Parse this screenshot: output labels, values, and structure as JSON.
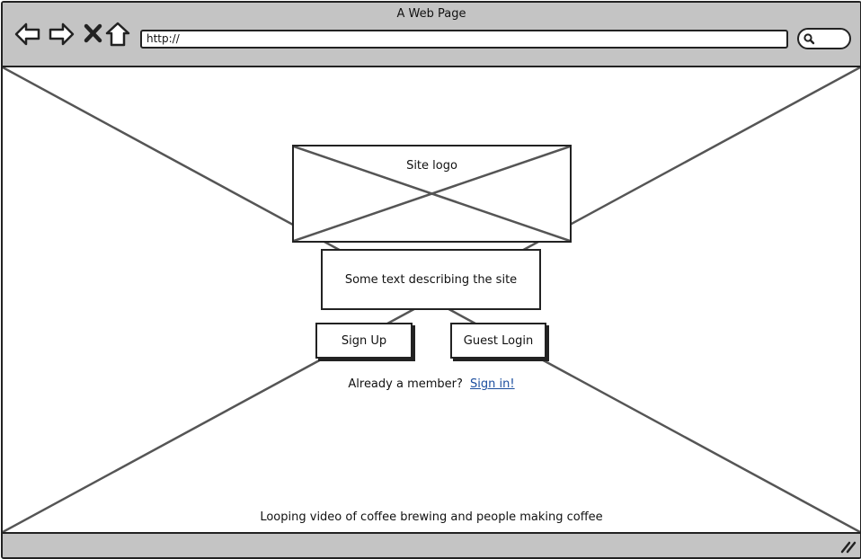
{
  "window": {
    "title": "A Web Page"
  },
  "toolbar": {
    "back_icon": "back-arrow-icon",
    "forward_icon": "forward-arrow-icon",
    "stop_icon": "close-icon",
    "home_icon": "home-icon",
    "url": "http://",
    "search_icon": "search-icon"
  },
  "main": {
    "logo_label": "Site logo",
    "description": "Some text describing the site",
    "signup_label": "Sign Up",
    "guest_login_label": "Guest Login",
    "member_prompt": "Already a member?",
    "signin_link": "Sign in!",
    "video_caption": "Looping video of coffee brewing and people making coffee"
  },
  "colors": {
    "chrome": "#c4c4c4",
    "stroke": "#222222",
    "link": "#1a4d9e"
  }
}
